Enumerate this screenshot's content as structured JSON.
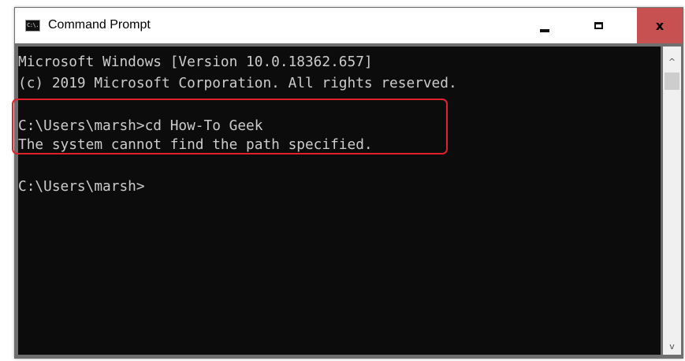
{
  "window": {
    "title": "Command Prompt",
    "icon_label": "C:\\.",
    "close_label": "x"
  },
  "console": {
    "lines": [
      "Microsoft Windows [Version 10.0.18362.657]",
      "(c) 2019 Microsoft Corporation. All rights reserved.",
      "",
      "C:\\Users\\marsh>cd How-To Geek",
      "The system cannot find the path specified.",
      "",
      "C:\\Users\\marsh>"
    ]
  },
  "scrollbar": {
    "up_arrow": "^",
    "down_arrow": "v"
  },
  "colors": {
    "console_background": "#0c0c0c",
    "console_text": "#cccccc",
    "highlight_border": "#e0202a",
    "close_button": "#c75050"
  },
  "icons": {
    "app": "command-prompt-icon",
    "minimize": "minimize-icon",
    "maximize": "maximize-icon",
    "close": "close-icon"
  }
}
